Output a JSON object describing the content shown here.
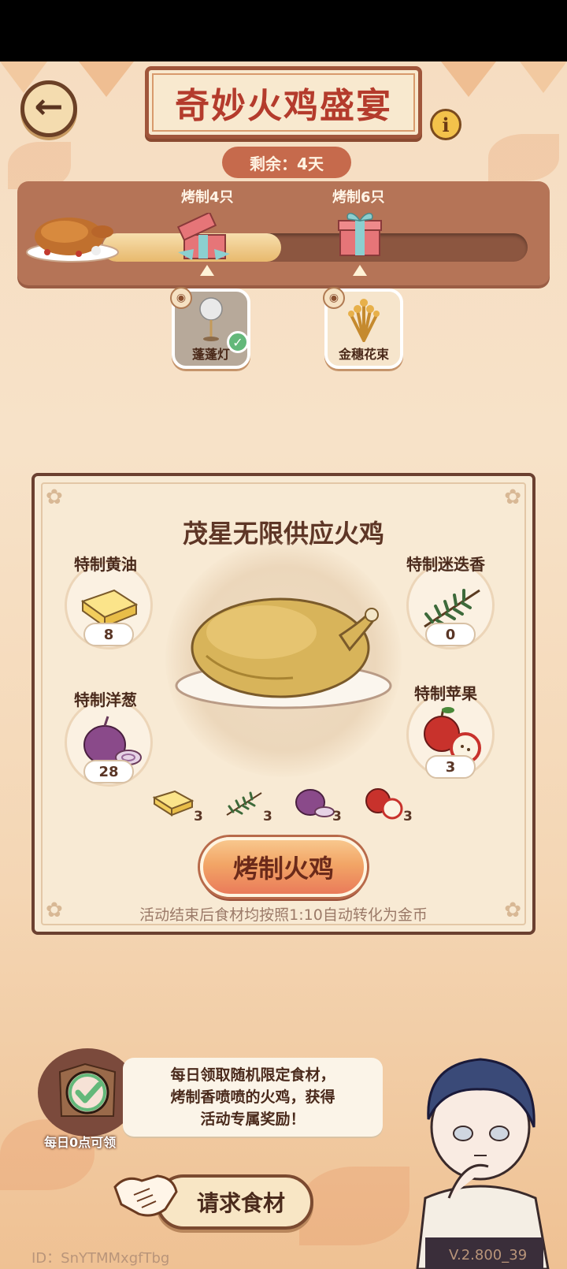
{
  "header": {
    "title": "奇妙火鸡盛宴",
    "back_icon": "arrow-left-icon",
    "info_icon": "info-icon",
    "info_text": "i",
    "remaining": "剩余：4天"
  },
  "progress": {
    "fill_fraction": 0.42,
    "milestones": [
      {
        "label": "烤制4只",
        "reward_name": "蓬蓬灯",
        "claimed": true,
        "check": "✓",
        "eye": "◉"
      },
      {
        "label": "烤制6只",
        "reward_name": "金穗花束",
        "claimed": false,
        "eye": "◉"
      }
    ]
  },
  "recipe": {
    "title": "茂星无限供应火鸡",
    "ingredients": [
      {
        "name": "特制黄油",
        "count": "8",
        "need": "3"
      },
      {
        "name": "特制迷迭香",
        "count": "0",
        "need": "3"
      },
      {
        "name": "特制洋葱",
        "count": "28",
        "need": "3"
      },
      {
        "name": "特制苹果",
        "count": "3",
        "need": "3"
      }
    ],
    "roast_button": "烤制火鸡",
    "note": "活动结束后食材均按照1:10自动转化为金币"
  },
  "daily": {
    "label": "每日0点可领",
    "speech_lines": [
      "每日领取随机限定食材，",
      "烤制香喷喷的火鸡，获得",
      "活动专属奖励！"
    ]
  },
  "request_button": "请求食材",
  "footer": {
    "id": "ID：SnYTMMxgfTbg",
    "version": "V.2.800_39"
  },
  "colors": {
    "title_red": "#b43b2c",
    "panel_brown": "#b57457",
    "button_orange": "#f2a566"
  }
}
